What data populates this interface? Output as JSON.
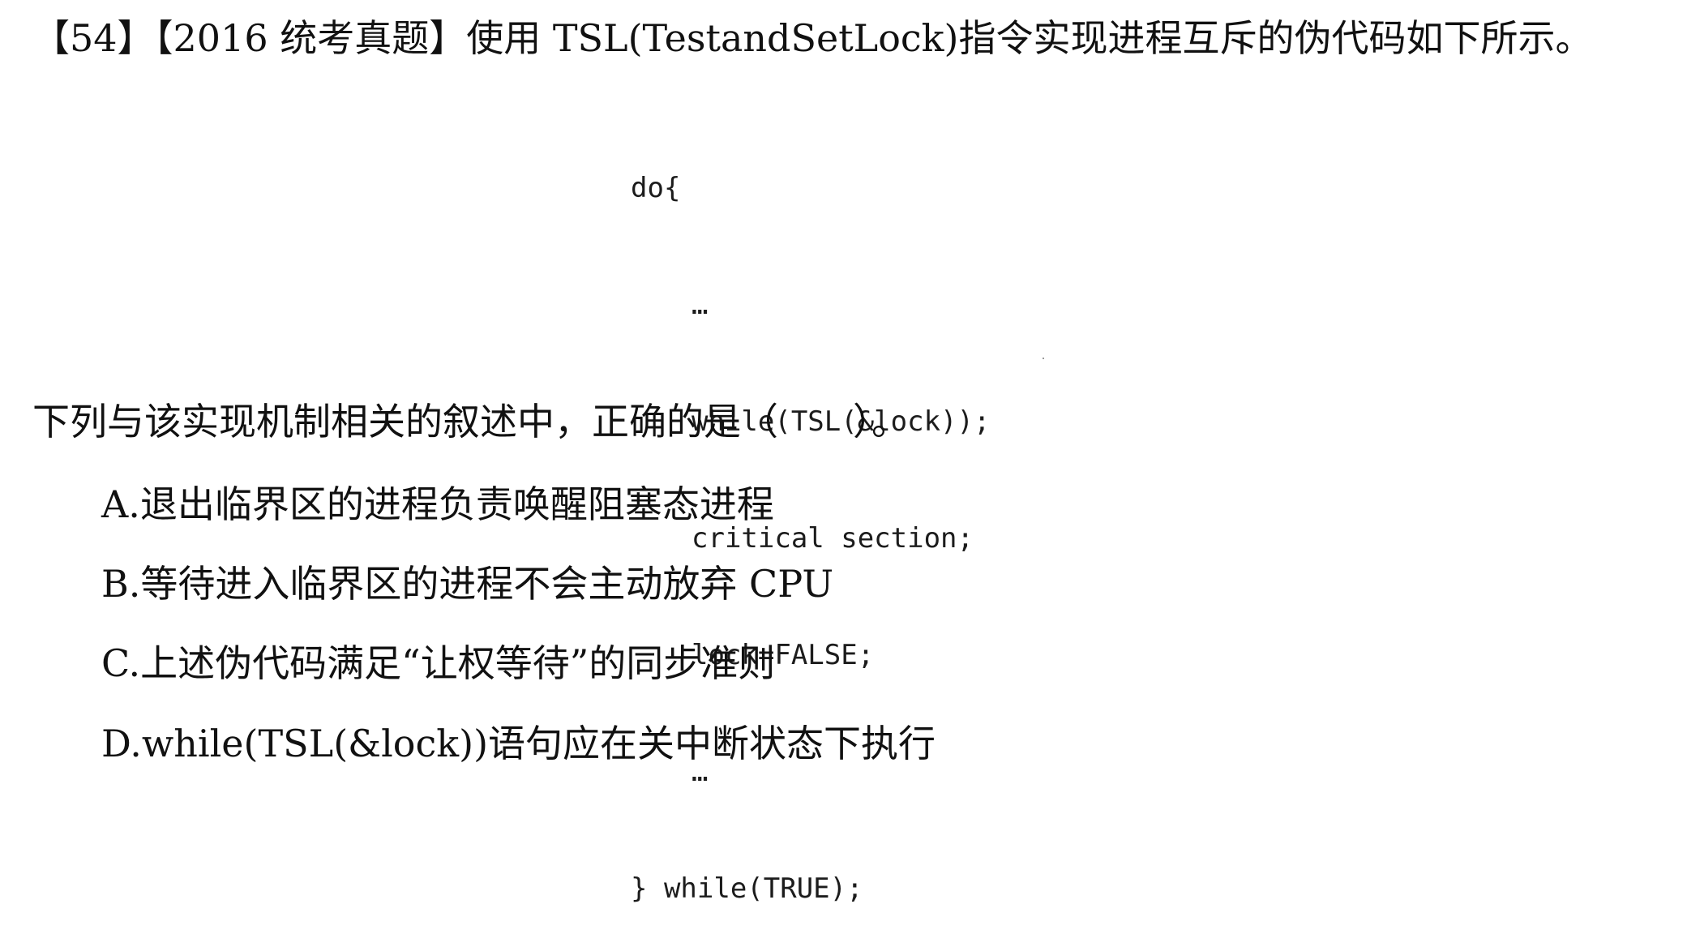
{
  "question": {
    "title": "【54】【2016 统考真题】使用 TSL(TestandSetLock)指令实现进程互斥的伪代码如下所示。",
    "code": [
      "do{",
      "…",
      "while(TSL(&lock));",
      "critical section;",
      "lock=FALSE;",
      "…",
      "} while(TRUE);"
    ],
    "stem": "下列与该实现机制相关的叙述中，正确的是（　　）。",
    "options": [
      "A.退出临界区的进程负责唤醒阻塞态进程",
      "B.等待进入临界区的进程不会主动放弃 CPU",
      "C.上述伪代码满足“让权等待”的同步准则",
      "D.while(TSL(&lock))语句应在关中断状态下执行"
    ]
  }
}
